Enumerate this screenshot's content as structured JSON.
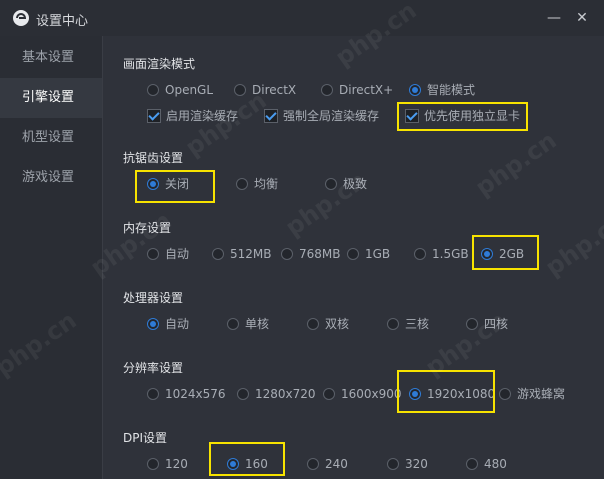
{
  "window": {
    "title": "设置中心",
    "minimize_icon": "minimize-icon",
    "close_icon": "close-icon"
  },
  "sidebar": {
    "items": [
      {
        "label": "基本设置",
        "active": false
      },
      {
        "label": "引擎设置",
        "active": true
      },
      {
        "label": "机型设置",
        "active": false
      },
      {
        "label": "游戏设置",
        "active": false
      }
    ]
  },
  "render": {
    "title": "画面渲染模式",
    "options": [
      "OpenGL",
      "DirectX",
      "DirectX+",
      "智能模式"
    ],
    "selected": "智能模式",
    "checks": [
      {
        "label": "启用渲染缓存",
        "checked": true
      },
      {
        "label": "强制全局渲染缓存",
        "checked": true
      },
      {
        "label": "优先使用独立显卡",
        "checked": true
      }
    ]
  },
  "aa": {
    "title": "抗锯齿设置",
    "options": [
      "关闭",
      "均衡",
      "极致"
    ],
    "selected": "关闭"
  },
  "memory": {
    "title": "内存设置",
    "options": [
      "自动",
      "512MB",
      "768MB",
      "1GB",
      "1.5GB",
      "2GB"
    ],
    "selected": "2GB"
  },
  "cpu": {
    "title": "处理器设置",
    "options": [
      "自动",
      "单核",
      "双核",
      "三核",
      "四核"
    ],
    "selected": "自动"
  },
  "resolution": {
    "title": "分辨率设置",
    "options": [
      "1024x576",
      "1280x720",
      "1600x900",
      "1920x1080",
      "游戏蜂窝"
    ],
    "selected": "1920x1080"
  },
  "dpi": {
    "title": "DPI设置",
    "options": [
      "120",
      "160",
      "240",
      "320",
      "480"
    ],
    "selected": "160"
  },
  "watermark": "php.cn",
  "colors": {
    "highlight": "#f7e300",
    "accent": "#2f7bd6",
    "background": "#2f323a"
  }
}
